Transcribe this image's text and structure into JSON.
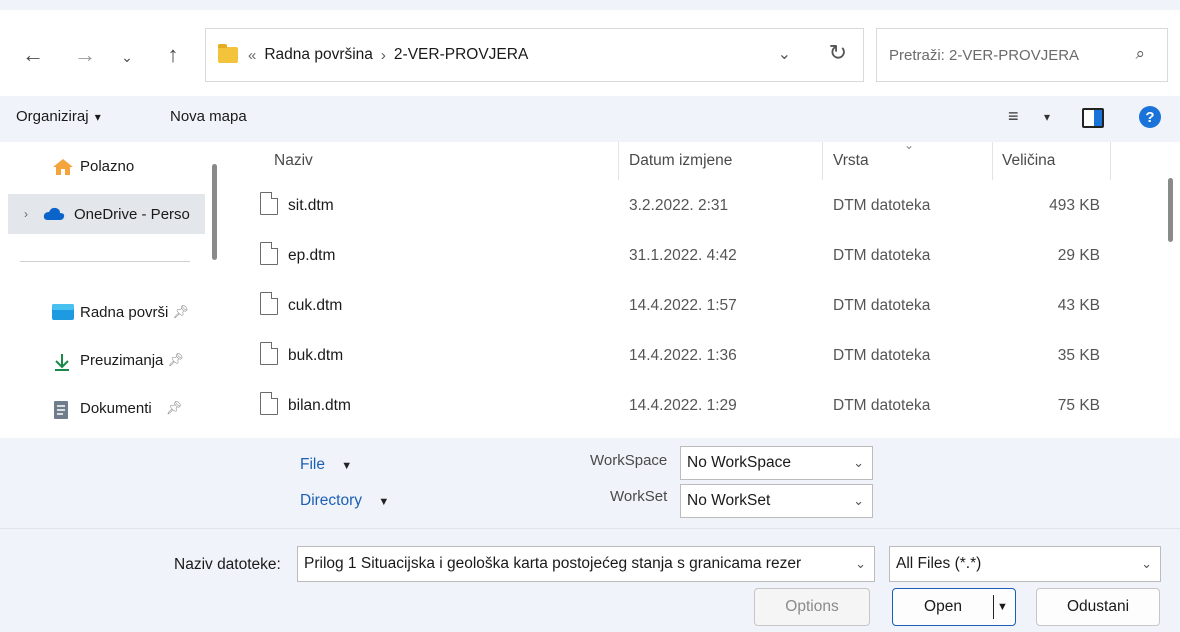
{
  "address": {
    "crumb_prefix": "«",
    "crumbs": [
      "Radna površina",
      "2-VER-PROVJERA"
    ],
    "separator": "›"
  },
  "search": {
    "placeholder": "Pretraži: 2-VER-PROVJERA"
  },
  "toolbar": {
    "organize_label": "Organiziraj",
    "organize_caret": "▾",
    "new_folder_label": "Nova mapa",
    "view_caret": "▾",
    "help_label": "?"
  },
  "nav": {
    "items": [
      {
        "label": "Polazno"
      },
      {
        "label": "OneDrive - Perso"
      },
      {
        "label": "Radna površi"
      },
      {
        "label": "Preuzimanja"
      },
      {
        "label": "Dokumenti"
      }
    ]
  },
  "files": {
    "columns": [
      "Naziv",
      "Datum izmjene",
      "Vrsta",
      "Veličina"
    ],
    "rows": [
      {
        "name": "sit.dtm",
        "date": "3.2.2022. 2:31",
        "type": "DTM datoteka",
        "size": "493 KB"
      },
      {
        "name": "ep.dtm",
        "date": "31.1.2022. 4:42",
        "type": "DTM datoteka",
        "size": "29 KB"
      },
      {
        "name": "cuk.dtm",
        "date": "14.4.2022. 1:57",
        "type": "DTM datoteka",
        "size": "43 KB"
      },
      {
        "name": "buk.dtm",
        "date": "14.4.2022. 1:36",
        "type": "DTM datoteka",
        "size": "35 KB"
      },
      {
        "name": "bilan.dtm",
        "date": "14.4.2022. 1:29",
        "type": "DTM datoteka",
        "size": "75 KB"
      }
    ]
  },
  "options_panel": {
    "file_label": "File",
    "directory_label": "Directory",
    "dropdown_caret": "▼",
    "workspace_label": "WorkSpace",
    "workspace_value": "No WorkSpace",
    "workset_label": "WorkSet",
    "workset_value": "No WorkSet"
  },
  "footer": {
    "filename_label": "Naziv datoteke:",
    "filename_value": "Prilog 1 Situacijska i geološka karta postojećeg stanja s granicama rezer",
    "filter_value": "All Files (*.*)",
    "options_label": "Options",
    "open_label": "Open",
    "cancel_label": "Odustani"
  },
  "colors": {
    "accent": "#1a73d9",
    "panel_bg": "#f0f3f9",
    "link": "#1a5fb4"
  }
}
